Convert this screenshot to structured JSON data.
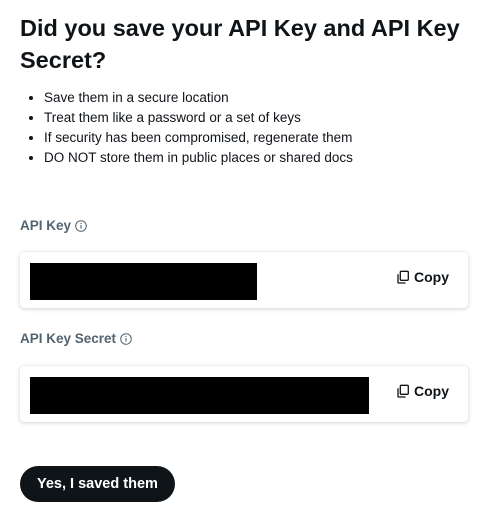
{
  "dialog": {
    "title": "Did you save your API Key and API Key Secret?",
    "tips": [
      "Save them in a secure location",
      "Treat them like a password or a set of keys",
      "If security has been compromised, regenerate them",
      "DO NOT store them in public places or shared docs"
    ]
  },
  "api_key": {
    "label": "API Key",
    "info_icon": "info-icon",
    "copy_label": "Copy",
    "copy_icon": "copy-icon"
  },
  "api_key_secret": {
    "label": "API Key Secret",
    "info_icon": "info-icon",
    "copy_label": "Copy",
    "copy_icon": "copy-icon"
  },
  "actions": {
    "confirm_label": "Yes, I saved them"
  }
}
